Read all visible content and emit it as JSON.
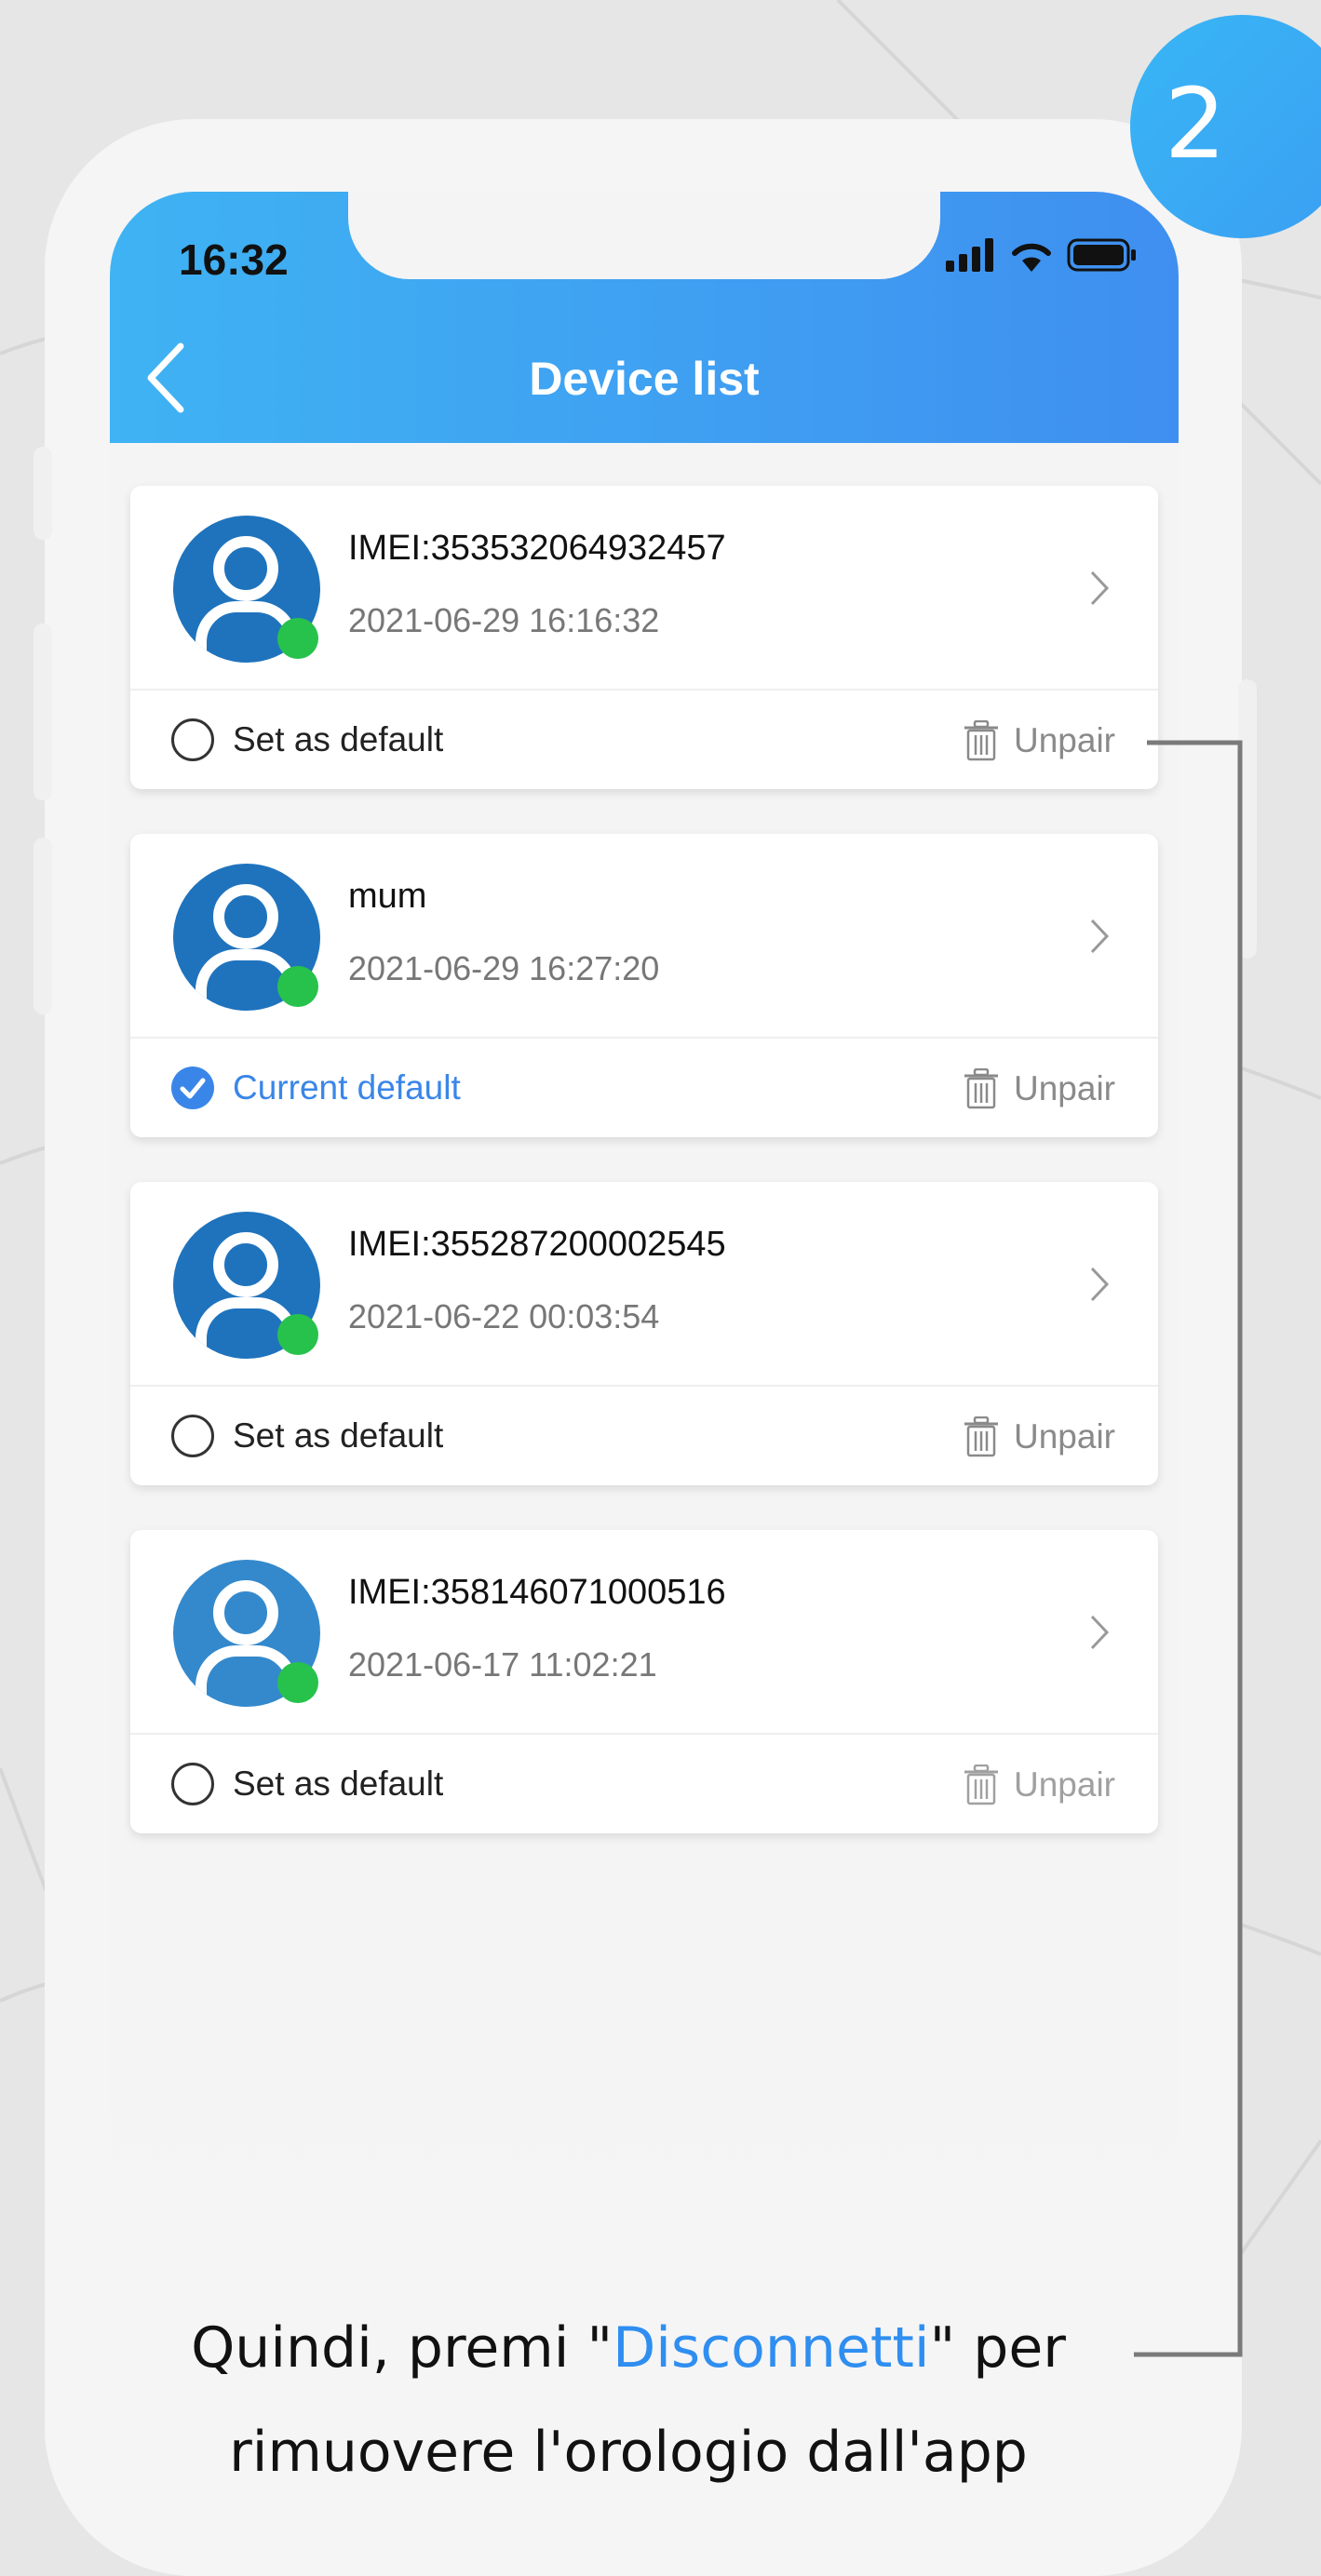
{
  "status": {
    "time": "16:32"
  },
  "header": {
    "title": "Device list"
  },
  "devices": [
    {
      "name": "IMEI:353532064932457",
      "date": "2021-06-29 16:16:32",
      "default_label": "Set as default",
      "is_default": false,
      "unpair": "Unpair"
    },
    {
      "name": "mum",
      "date": "2021-06-29 16:27:20",
      "default_label": "Current default",
      "is_default": true,
      "unpair": "Unpair"
    },
    {
      "name": "IMEI:355287200002545",
      "date": "2021-06-22 00:03:54",
      "default_label": "Set as default",
      "is_default": false,
      "unpair": "Unpair"
    },
    {
      "name": "IMEI:358146071000516",
      "date": "2021-06-17 11:02:21",
      "default_label": "Set as default",
      "is_default": false,
      "unpair": "Unpair"
    }
  ],
  "step_badge": "2",
  "caption": {
    "line1_before": "Quindi, premi \"",
    "line1_highlight": "Disconnetti",
    "line1_after": "\" per",
    "line2": "rimuovere l'orologio dall'app"
  },
  "colors": {
    "header_gradient": [
      "#3fb3f3",
      "#3f8ff0"
    ],
    "accent": "#3a86e8",
    "online_dot": "#27c24c",
    "avatar": "#1f73bd",
    "caption_highlight": "#2f8ef0"
  },
  "icons": [
    "back-arrow-icon",
    "signal-icon",
    "wifi-icon",
    "battery-icon",
    "avatar-icon",
    "chevron-right-icon",
    "radio-icon",
    "checkmark-icon",
    "trash-icon"
  ]
}
